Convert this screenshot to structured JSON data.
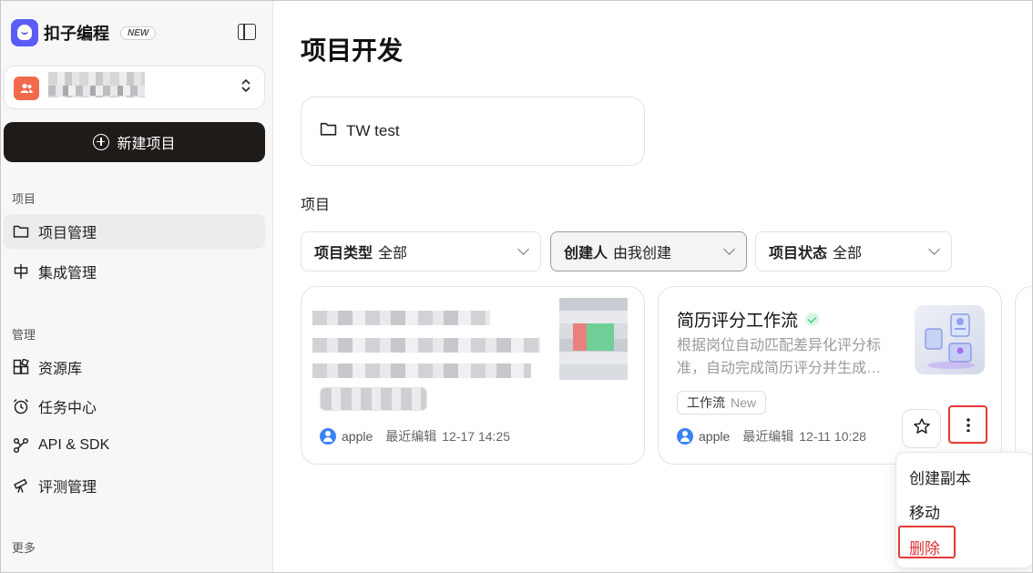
{
  "app": {
    "brand_name": "扣子编程",
    "new_badge": "NEW",
    "brand_color": "#5b5cf6"
  },
  "sidebar": {
    "workspace_icon": "team-icon",
    "new_project_label": "新建项目",
    "section_project": "项目",
    "section_manage": "管理",
    "section_more": "更多",
    "items": [
      {
        "label": "项目管理",
        "icon": "folder-icon"
      },
      {
        "label": "集成管理",
        "icon": "integration-icon"
      },
      {
        "label": "资源库",
        "icon": "resource-icon"
      },
      {
        "label": "任务中心",
        "icon": "alarm-clock-icon"
      },
      {
        "label": "API & SDK",
        "icon": "api-icon"
      },
      {
        "label": "评测管理",
        "icon": "telescope-icon"
      }
    ]
  },
  "main": {
    "title": "项目开发",
    "folder_name": "TW test",
    "section_title": "项目",
    "filters": [
      {
        "label": "项目类型",
        "value": "全部"
      },
      {
        "label": "创建人",
        "value": "由我创建"
      },
      {
        "label": "项目状态",
        "value": "全部"
      }
    ]
  },
  "cards": [
    {
      "author": "apple",
      "edited_label": "最近编辑",
      "edited_time": "12-17 14:25"
    },
    {
      "title": "简历评分工作流",
      "description": "根据岗位自动匹配差异化评分标准，自动完成简历评分并生成…",
      "tag": "工作流",
      "tag_new": "New",
      "author": "apple",
      "edited_label": "最近编辑",
      "edited_time": "12-11 10:28"
    }
  ],
  "context_menu": {
    "items": [
      "创建副本",
      "移动",
      "删除"
    ],
    "delete_color": "#e03131"
  }
}
